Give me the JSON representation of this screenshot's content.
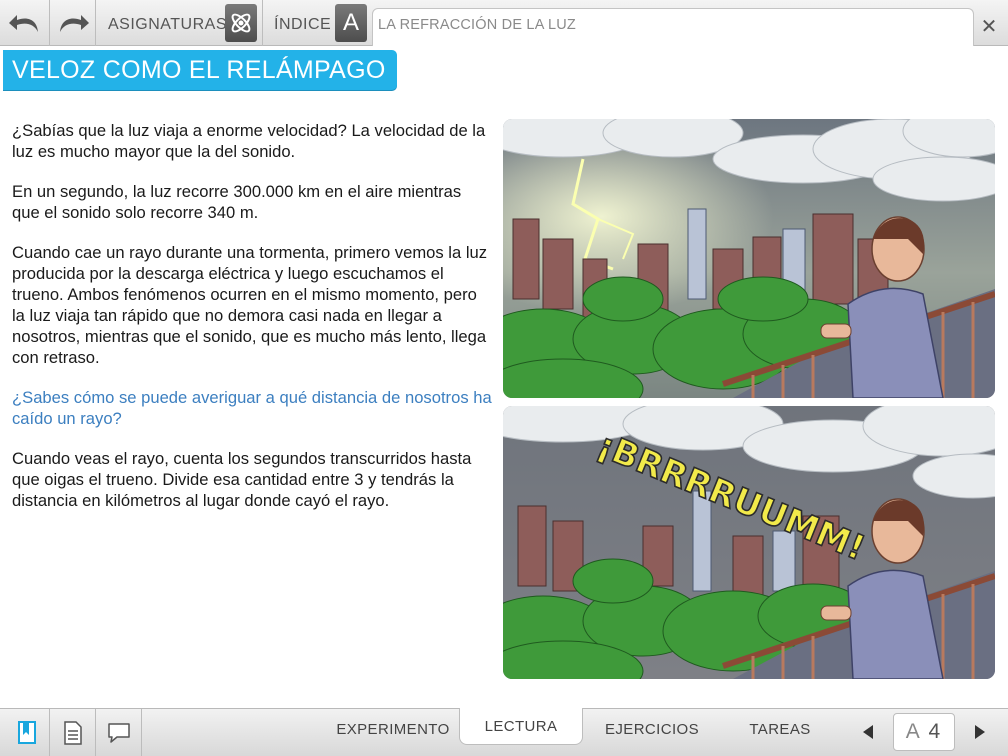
{
  "toolbar": {
    "undo_icon": "undo-arrow-icon",
    "redo_icon": "redo-arrow-icon",
    "subjects_label": "ASIGNATURAS",
    "subjects_icon": "atom-icon",
    "index_label": "ÍNDICE",
    "index_letter": "A",
    "breadcrumb": "LA REFRACCIÓN DE LA LUZ",
    "close_label": "✕"
  },
  "page": {
    "title": "VELOZ COMO EL RELÁMPAGO",
    "accent_color": "#23b2e8",
    "question_color": "#3c7fc0"
  },
  "article": {
    "paragraphs": [
      "¿Sabías que la luz viaja a enorme velocidad? La velocidad de la luz es mucho mayor que la del sonido.",
      "En un segundo, la luz recorre 300.000 km en el aire mientras que el sonido solo recorre 340 m.",
      "Cuando cae un rayo durante una tormenta, primero vemos la luz producida por la descarga eléctrica y luego escuchamos el trueno. Ambos fenómenos ocurren en el mismo momento, pero la luz viaja tan rápido que no demora casi nada en llegar a nosotros, mientras que el sonido, que es mucho más lento, llega con retraso.",
      "¿Sabes cómo se puede averiguar a qué distancia de nosotros ha caído un rayo?",
      "Cuando veas el rayo, cuenta los segundos transcurridos hasta que oigas el trueno. Divide esa cantidad entre 3 y tendrás la distancia en kilómetros al lugar donde cayó el rayo."
    ]
  },
  "illustrations": {
    "thunder_text": "¡BRRRRUUMM!"
  },
  "bottombar": {
    "bookmark_icon": "bookmark-icon",
    "notes_icon": "document-icon",
    "comment_icon": "speech-bubble-icon",
    "tabs": [
      "EXPERIMENTO",
      "LECTURA",
      "EJERCICIOS",
      "TAREAS"
    ],
    "active_tab": "LECTURA",
    "font_size_letter": "A",
    "page_number": "4"
  }
}
